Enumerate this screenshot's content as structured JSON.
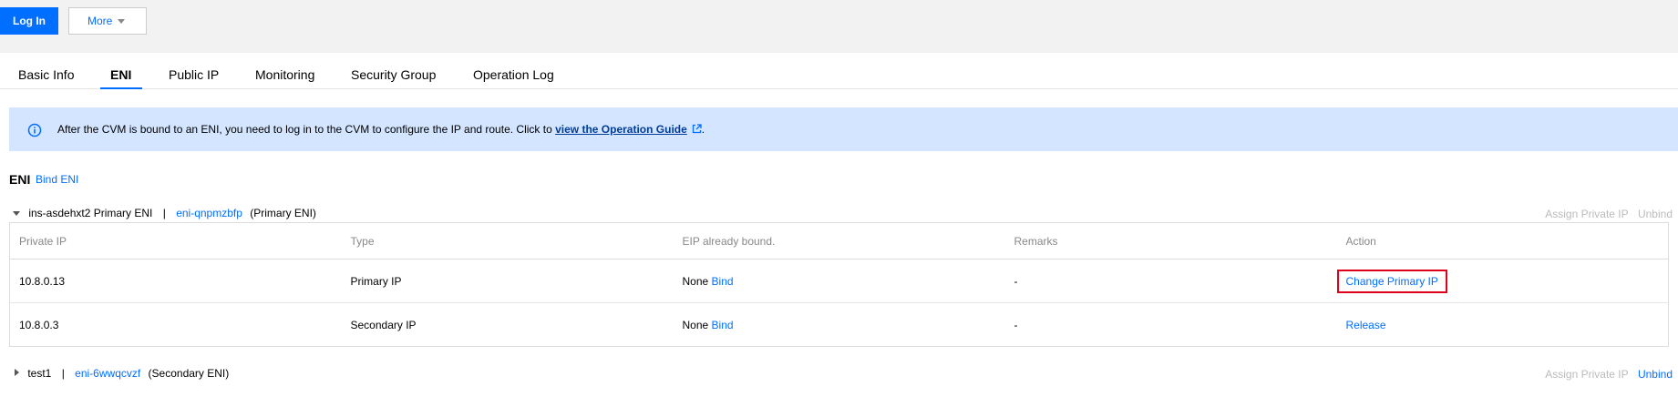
{
  "toolbar": {
    "login_label": "Log In",
    "more_label": "More"
  },
  "tabs": [
    {
      "label": "Basic Info"
    },
    {
      "label": "ENI"
    },
    {
      "label": "Public IP"
    },
    {
      "label": "Monitoring"
    },
    {
      "label": "Security Group"
    },
    {
      "label": "Operation Log"
    }
  ],
  "notice": {
    "text": "After the CVM is bound to an ENI, you need to log in to the CVM to configure the IP and route. Click to",
    "link_label": "view the Operation Guide",
    "suffix": "."
  },
  "section": {
    "title": "ENI",
    "bind_label": "Bind ENI"
  },
  "enis": [
    {
      "name": "ins-asdehxt2 Primary ENI",
      "id": "eni-qnpmzbfp",
      "role": "(Primary ENI)",
      "assign_label": "Assign Private IP",
      "unbind_label": "Unbind"
    },
    {
      "name": "test1",
      "id": "eni-6wwqcvzf",
      "role": "(Secondary ENI)",
      "assign_label": "Assign Private IP",
      "unbind_label": "Unbind"
    }
  ],
  "table": {
    "headers": [
      "Private IP",
      "Type",
      "EIP already bound.",
      "Remarks",
      "Action"
    ],
    "rows": [
      {
        "ip": "10.8.0.13",
        "type": "Primary IP",
        "eip": "None",
        "bind_label": "Bind",
        "remarks": "-",
        "action": "Change Primary IP"
      },
      {
        "ip": "10.8.0.3",
        "type": "Secondary IP",
        "eip": "None",
        "bind_label": "Bind",
        "remarks": "-",
        "action": "Release"
      }
    ]
  },
  "colors": {
    "accent": "#006eff",
    "highlight": "#e0001a",
    "notice_bg": "#d4e5ff"
  }
}
